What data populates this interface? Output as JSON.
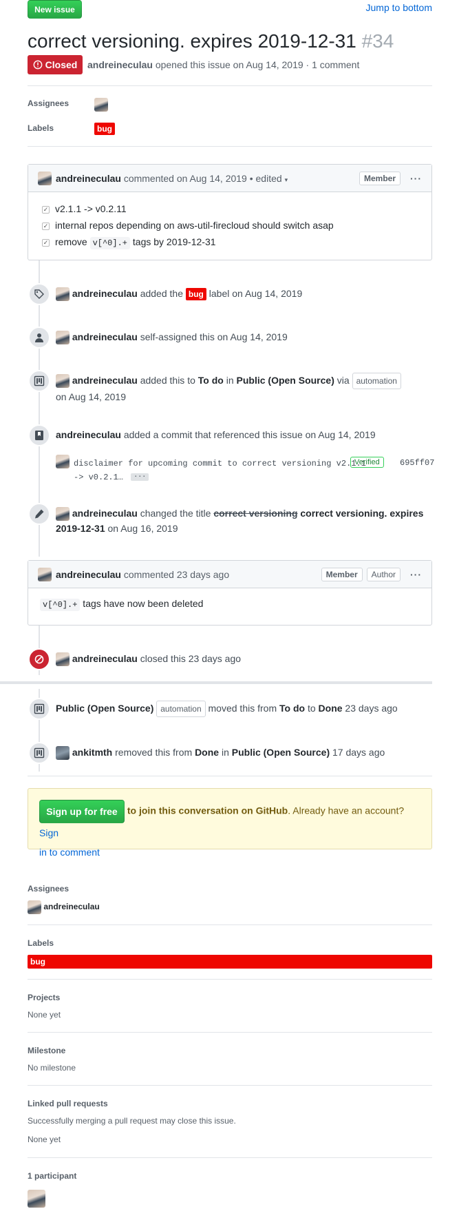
{
  "header": {
    "new_issue": "New issue",
    "jump_to_bottom": "Jump to bottom"
  },
  "issue": {
    "title": "correct versioning. expires 2019-12-31",
    "number": "#34",
    "state": "Closed",
    "author": "andreineculau",
    "opened_text": "opened this issue on Aug 14, 2019 · 1 comment"
  },
  "meta": {
    "assignees_label": "Assignees",
    "labels_label": "Labels",
    "label_bug": "bug"
  },
  "first_comment": {
    "author": "andreineculau",
    "date_text": "commented on Aug 14, 2019",
    "edited": "• edited",
    "member_badge": "Member",
    "tasks": [
      {
        "pre": "v2.1.1 -> v0.2.11",
        "code": "",
        "post": ""
      },
      {
        "pre": "internal repos depending on aws-util-firecloud should switch asap",
        "code": "",
        "post": ""
      },
      {
        "pre": "remove ",
        "code": "v[^0].+",
        "post": " tags by 2019-12-31"
      }
    ]
  },
  "events": {
    "label_added": {
      "actor": "andreineculau",
      "pre": "added the",
      "label": "bug",
      "post": "label on Aug 14, 2019"
    },
    "self_assigned": {
      "actor": "andreineculau",
      "text": "self-assigned this on Aug 14, 2019"
    },
    "project_added": {
      "actor": "andreineculau",
      "t1": "added this to",
      "column": "To do",
      "t2": "in",
      "project": "Public (Open Source)",
      "t3": "via",
      "automation": "automation",
      "date": "on Aug 14, 2019"
    },
    "commit_ref": {
      "actor": "andreineculau",
      "text": "added a commit that referenced this issue on Aug 14, 2019"
    },
    "commit": {
      "message_line1": "disclaimer for upcoming commit to correct versioning v2.1.1",
      "message_line2": "-> v0.2.1…",
      "ellipsis": "…",
      "verified": "Verified",
      "sha": "695ff07"
    },
    "title_changed": {
      "actor": "andreineculau",
      "t1": "changed the title",
      "old_title": "correct versioning",
      "new_title": "correct versioning. expires 2019-12-31",
      "date": "on Aug 16, 2019"
    },
    "closed": {
      "actor": "andreineculau",
      "text": "closed this 23 days ago"
    },
    "moved": {
      "project": "Public (Open Source)",
      "automation": "automation",
      "t1": "moved this from",
      "from": "To do",
      "t2": "to",
      "to": "Done",
      "date": "23 days ago"
    },
    "removed": {
      "actor": "ankitmth",
      "t1": "removed this from",
      "column": "Done",
      "t2": "in",
      "project": "Public (Open Source)",
      "date": "17 days ago"
    }
  },
  "second_comment": {
    "author": "andreineculau",
    "date_text": "commented 23 days ago",
    "member_badge": "Member",
    "author_badge": "Author",
    "code": "v[^0].+",
    "body": " tags have now been deleted"
  },
  "signup": {
    "button": "Sign up for free",
    "bold_text": "to join this conversation on GitHub",
    "text": ". Already have an account?",
    "link_1": "Sign",
    "link_2": "in to comment"
  },
  "sidebar": {
    "assignees_h": "Assignees",
    "assignee": "andreineculau",
    "labels_h": "Labels",
    "label": "bug",
    "projects_h": "Projects",
    "projects_v": "None yet",
    "milestone_h": "Milestone",
    "milestone_v": "No milestone",
    "linked_h": "Linked pull requests",
    "linked_desc": "Successfully merging a pull request may close this issue.",
    "linked_v": "None yet",
    "participants_h": "1 participant"
  },
  "colors": {
    "accent_green": "#28a745",
    "closed_red": "#cb2431",
    "label_bug": "#ee0701",
    "link_blue": "#0366d6"
  }
}
